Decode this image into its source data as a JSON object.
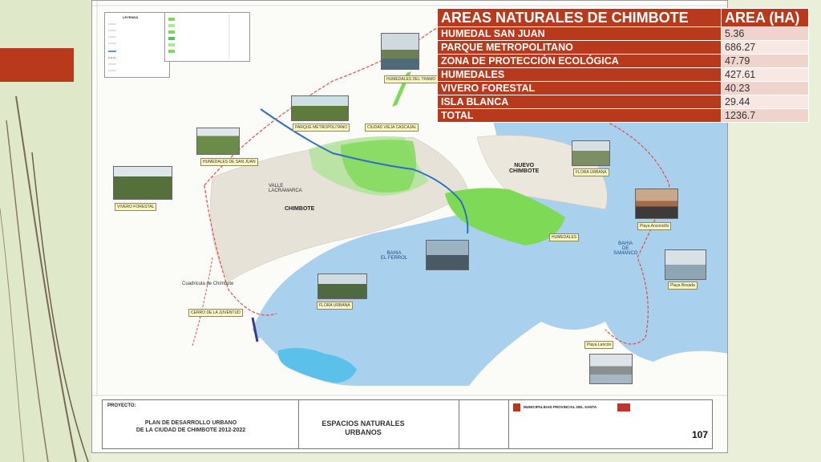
{
  "table": {
    "header_name": "AREAS NATURALES DE CHIMBOTE",
    "header_area": "AREA (HA)",
    "rows": [
      {
        "name": "HUMEDAL SAN JUAN",
        "area": "5.36"
      },
      {
        "name": "PARQUE METROPOLITANO",
        "area": "686.27"
      },
      {
        "name": "ZONA DE PROTECCIÓN ECOLÓGICA",
        "area": "47.79"
      },
      {
        "name": "HUMEDALES",
        "area": "427.61"
      },
      {
        "name": "VIVERO FORESTAL",
        "area": "40.23"
      },
      {
        "name": "ISLA BLANCA",
        "area": "29.44"
      },
      {
        "name": "TOTAL",
        "area": "1236.7"
      }
    ]
  },
  "map": {
    "legend_title": "LEYENDA",
    "place_labels": {
      "nuevo_chimbote": "NUEVO\nCHIMBOTE",
      "chimbote": "CHIMBOTE",
      "valle": "VALLE\nLACRAMARCA",
      "bahia_ferrol": "BAHIA\nEL FERROL",
      "bahia_samanco": "BAHIA\nDE\nSAMANCO",
      "cuadricula": "Cuadricula de Chimbote"
    },
    "callouts": {
      "humedales_del_tram": "HUMEDALES DEL TRAMO",
      "parque_metropolitano": "PARQUE METROPOLITANO",
      "ciudad_vieja": "CIUDAD VIEJA CASCAJAL",
      "humedales_san_juan": "HUMEDALES DE SAN JUAN",
      "vivero_forestal": "VIVERO FORESTAL",
      "flora_urbana_top": "FLORA URBANA",
      "humedales": "HUMEDALES",
      "playa_anconcillo": "Playa Anconcillo",
      "playa_besada": "Playa Besada",
      "flora_urbana": "FLORA URBANA",
      "cerro_juventud": "CERRO DE LA JUVENTUD",
      "playa_lancon": "Playa Lancón"
    },
    "colors": {
      "sea": "#a9d1ee",
      "land": "#fbfbf8",
      "wetland": "#7ed957",
      "park": "#b7e3a1",
      "river": "#2f6fc1",
      "boundary": "#e0504a",
      "island": "#5bc0ea"
    }
  },
  "title_block": {
    "proyecto_label": "PROYECTO:",
    "plan": "PLAN DE DESARROLLO URBANO\nDE LA CIUDAD DE CHIMBOTE 2012-2022",
    "espacios": "ESPACIOS NATURALES\nURBANOS",
    "municipalidad": "MUNICIPALIDAD PROVINCIAL DEL SANTA",
    "sheet_number": "107"
  }
}
